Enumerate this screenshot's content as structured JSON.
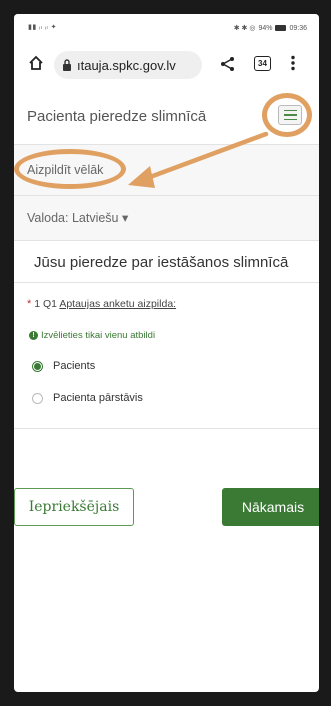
{
  "status_bar": {
    "left": "",
    "battery": "94%",
    "time": "09:36"
  },
  "browser": {
    "url": "ıtauja.spkc.gov.lv",
    "tab_count": "34"
  },
  "survey": {
    "title": "Pacienta pieredze slimnīcā",
    "fill_later": "Aizpildīt vēlāk",
    "language": "Valoda: Latviešu",
    "page_title": "Jūsu pieredze par iestāšanos slimnīcā"
  },
  "question": {
    "number": "1",
    "code": "Q1",
    "text": "Aptaujas anketu aizpilda:",
    "hint": "Izvēlieties tikai vienu atbildi",
    "options": [
      {
        "label": "Pacients",
        "selected": true
      },
      {
        "label": "Pacienta pārstāvis",
        "selected": false
      }
    ]
  },
  "nav": {
    "prev_label": "Iepriekšējais",
    "next_label": "Nākamais"
  },
  "colors": {
    "accent_green": "#3a7a34",
    "annotation_orange": "#e0a062"
  }
}
